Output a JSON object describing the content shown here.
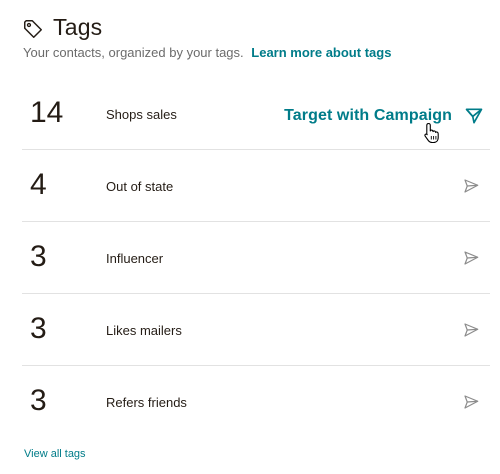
{
  "header": {
    "title": "Tags",
    "subtitle": "Your contacts, organized by your tags.",
    "learn_more_link": "Learn more about tags",
    "icon": "tag-icon"
  },
  "tags": [
    {
      "count": "14",
      "name": "Shops sales",
      "action": "Target with Campaign"
    },
    {
      "count": "4",
      "name": "Out of state"
    },
    {
      "count": "3",
      "name": "Influencer"
    },
    {
      "count": "3",
      "name": "Likes mailers"
    },
    {
      "count": "3",
      "name": "Refers friends"
    }
  ],
  "footer": {
    "view_all_link": "View all tags"
  },
  "colors": {
    "accent": "#007c89",
    "text": "#241c15",
    "muted": "#6b6b6b",
    "divider": "#e2e2e2",
    "icon_gray": "#8c8c8c"
  },
  "icons": {
    "send": "paper-plane-icon",
    "cursor": "hand-pointer-icon"
  }
}
